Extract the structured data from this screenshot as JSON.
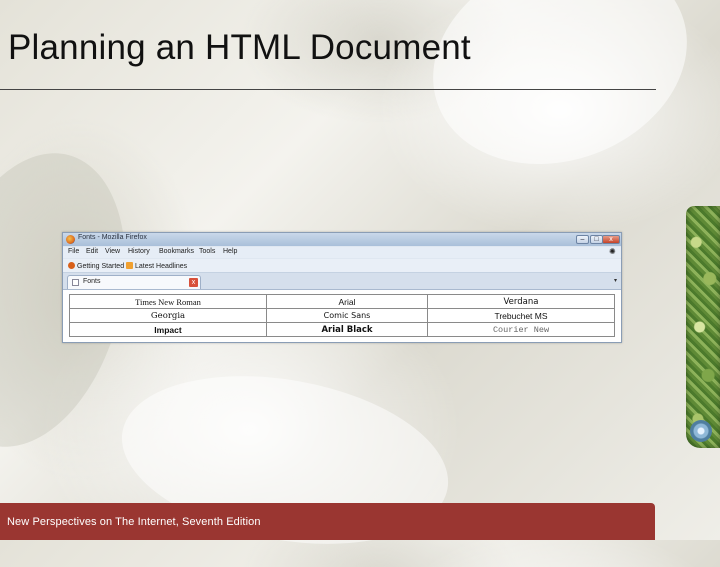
{
  "slide": {
    "title": "Planning an HTML Document",
    "footer": "New Perspectives on The Internet, Seventh Edition"
  },
  "browser": {
    "window_title": "Fonts - Mozilla Firefox",
    "window_buttons": {
      "minimize": "–",
      "maximize": "□",
      "close": "x"
    },
    "menu": [
      "File",
      "Edit",
      "View",
      "History",
      "Bookmarks",
      "Tools",
      "Help"
    ],
    "bookmarks": [
      "Getting Started",
      "Latest Headlines"
    ],
    "tab": {
      "label": "Fonts",
      "close": "x",
      "list_arrow": "▾"
    },
    "font_table": [
      [
        "Times New Roman",
        "Arial",
        "Verdana"
      ],
      [
        "Georgia",
        "Comic Sans",
        "Trebuchet MS"
      ],
      [
        "Impact",
        "Arial Black",
        "Courier New"
      ]
    ]
  },
  "colors": {
    "footer_bar": "#9a3631",
    "title_rule": "#444444"
  },
  "icons": [
    "firefox-icon",
    "bookmark-star-icon",
    "rss-feed-icon",
    "page-icon",
    "tab-close-icon",
    "chevron-down-icon",
    "plant-decoration"
  ]
}
